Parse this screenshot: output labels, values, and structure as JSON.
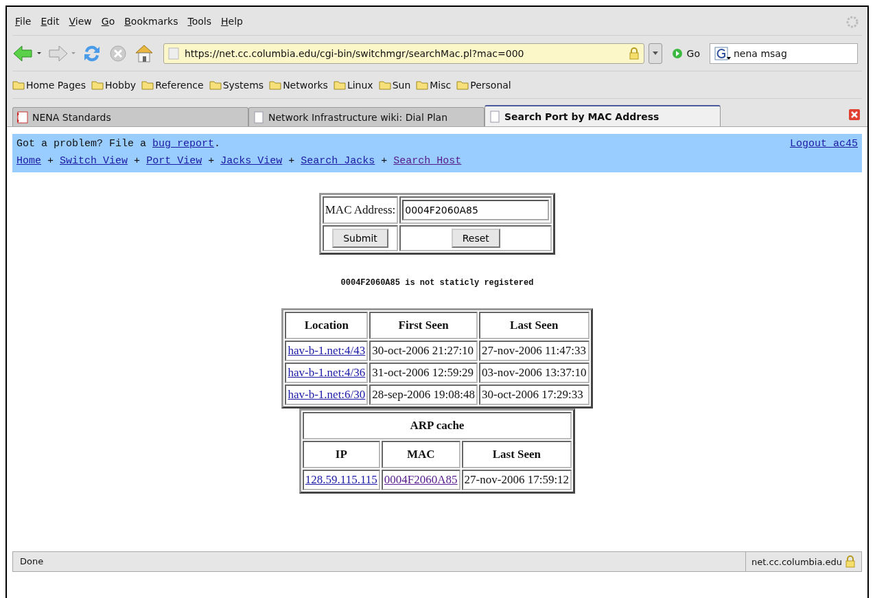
{
  "menu": [
    {
      "accel": "F",
      "rest": "ile"
    },
    {
      "accel": "E",
      "rest": "dit"
    },
    {
      "accel": "V",
      "rest": "iew"
    },
    {
      "accel": "G",
      "rest": "o"
    },
    {
      "accel": "B",
      "rest": "ookmarks"
    },
    {
      "accel": "T",
      "rest": "ools"
    },
    {
      "accel": "H",
      "rest": "elp"
    }
  ],
  "url": "https://net.cc.columbia.edu/cgi-bin/switchmgr/searchMac.pl?mac=000",
  "go_label": "Go",
  "search_value": "nena msag",
  "bookmarks": [
    "Home Pages",
    "Hobby",
    "Reference",
    "Systems",
    "Networks",
    "Linux",
    "Sun",
    "Misc",
    "Personal"
  ],
  "tabs": [
    {
      "label": "NENA Standards",
      "selected": false
    },
    {
      "label": "Network Infrastructure wiki: Dial Plan",
      "selected": false
    },
    {
      "label": "Search Port by MAC Address",
      "selected": true
    }
  ],
  "banner": {
    "problem_text": "Got a problem? File a",
    "problem_link": "bug report",
    "problem_end": ".",
    "logout": "Logout ac45",
    "nav": [
      {
        "label": "Home",
        "visited": false
      },
      {
        "label": "Switch View",
        "visited": false
      },
      {
        "label": "Port View",
        "visited": false
      },
      {
        "label": "Jacks View",
        "visited": false
      },
      {
        "label": "Search Jacks",
        "visited": false
      },
      {
        "label": "Search Host",
        "visited": true
      }
    ],
    "separator": "+"
  },
  "form": {
    "label": "MAC Address:",
    "value": "0004F2060A85",
    "submit": "Submit",
    "reset": "Reset"
  },
  "message": "0004F2060A85 is not staticly registered",
  "locations": {
    "columns": [
      "Location",
      "First Seen",
      "Last Seen"
    ],
    "rows": [
      [
        "hav-b-1.net:4/43",
        "30-oct-2006 21:27:10",
        "27-nov-2006 11:47:33"
      ],
      [
        "hav-b-1.net:4/36",
        "31-oct-2006 12:59:29",
        "03-nov-2006 13:37:10"
      ],
      [
        "hav-b-1.net:6/30",
        "28-sep-2006 19:08:48",
        "30-oct-2006 17:29:33"
      ]
    ]
  },
  "arp": {
    "title": "ARP cache",
    "columns": [
      "IP",
      "MAC",
      "Last Seen"
    ],
    "rows": [
      {
        "ip": "128.59.115.115",
        "ip_visited": false,
        "mac": "0004F2060A85",
        "mac_visited": true,
        "last_seen": "27-nov-2006 17:59:12"
      }
    ]
  },
  "status_bar": {
    "text": "Done",
    "host": "net.cc.columbia.edu"
  }
}
